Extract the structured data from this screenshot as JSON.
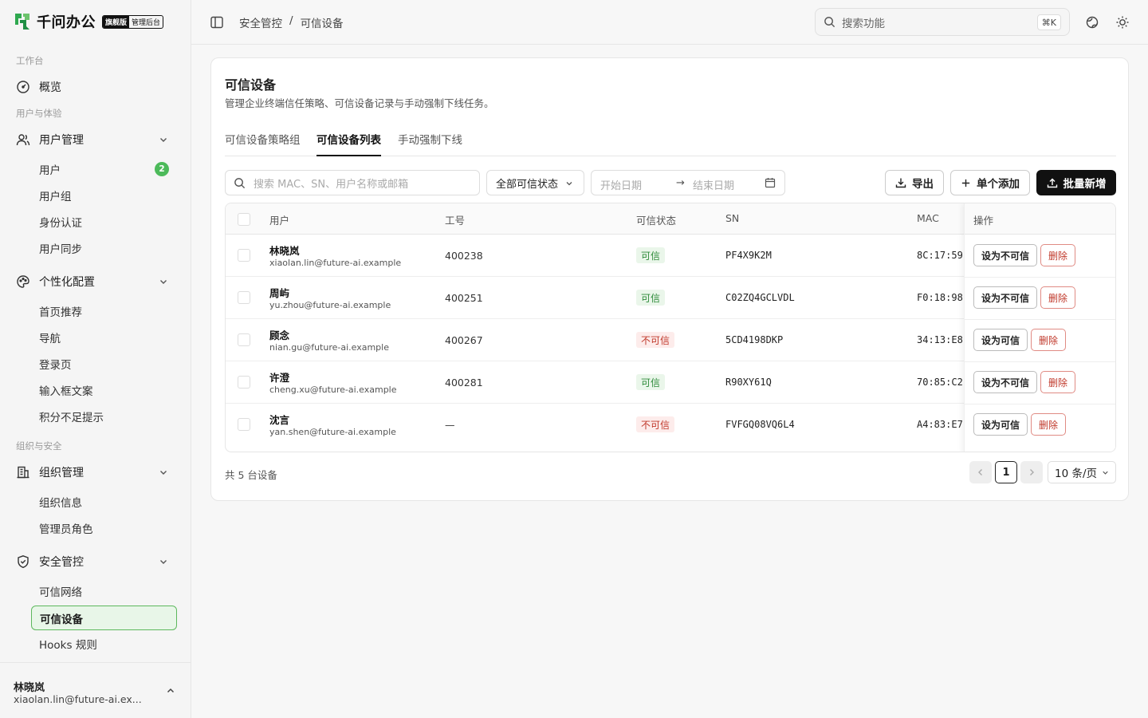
{
  "brand": {
    "name": "千问办公",
    "edition": "旗舰版",
    "console": "管理后台"
  },
  "sidebar": {
    "groups": {
      "workspace": "工作台",
      "users_exp": "用户与体验",
      "org_sec": "组织与安全"
    },
    "overview": "概览",
    "user_mgmt": {
      "label": "用户管理",
      "items": [
        {
          "label": "用户",
          "count": "2"
        },
        {
          "label": "用户组"
        },
        {
          "label": "身份认证"
        },
        {
          "label": "用户同步"
        }
      ]
    },
    "personal": {
      "label": "个性化配置",
      "items": [
        {
          "label": "首页推荐"
        },
        {
          "label": "导航"
        },
        {
          "label": "登录页"
        },
        {
          "label": "输入框文案"
        },
        {
          "label": "积分不足提示"
        }
      ]
    },
    "org_mgmt": {
      "label": "组织管理",
      "items": [
        {
          "label": "组织信息"
        },
        {
          "label": "管理员角色"
        }
      ]
    },
    "security": {
      "label": "安全管控",
      "items": [
        {
          "label": "可信网络"
        },
        {
          "label": "可信设备"
        },
        {
          "label": "Hooks 规则"
        }
      ]
    },
    "user": {
      "name": "林晓岚",
      "email": "xiaolan.lin@future-ai.ex..."
    }
  },
  "header": {
    "breadcrumb": [
      "安全管控",
      "/",
      "可信设备"
    ],
    "search_placeholder": "搜索功能",
    "shortcut": "⌘K"
  },
  "page": {
    "title": "可信设备",
    "description": "管理企业终端信任策略、可信设备记录与手动强制下线任务。",
    "tabs": [
      "可信设备策略组",
      "可信设备列表",
      "手动强制下线"
    ],
    "active_tab": 1
  },
  "toolbar": {
    "search_placeholder": "搜索 MAC、SN、用户名称或邮箱",
    "status_filter": "全部可信状态",
    "start_date": "开始日期",
    "range_arrow": "→",
    "end_date": "结束日期",
    "export": "导出",
    "add_single": "单个添加",
    "batch_add": "批量新增"
  },
  "table": {
    "columns": [
      "用户",
      "工号",
      "可信状态",
      "SN",
      "MAC",
      "操作"
    ],
    "rows": [
      {
        "name": "林晓岚",
        "email": "xiaolan.lin@future-ai.example",
        "emp_no": "400238",
        "status": "可信",
        "trusted": true,
        "sn": "PF4X9K2M",
        "mac": "8C:17:59",
        "toggle": "设为不可信",
        "delete": "删除"
      },
      {
        "name": "周屿",
        "email": "yu.zhou@future-ai.example",
        "emp_no": "400251",
        "status": "可信",
        "trusted": true,
        "sn": "C02ZQ4GCLVDL",
        "mac": "F0:18:98",
        "toggle": "设为不可信",
        "delete": "删除"
      },
      {
        "name": "顾念",
        "email": "nian.gu@future-ai.example",
        "emp_no": "400267",
        "status": "不可信",
        "trusted": false,
        "sn": "5CD4198DKP",
        "mac": "34:13:E8",
        "toggle": "设为可信",
        "delete": "删除"
      },
      {
        "name": "许澄",
        "email": "cheng.xu@future-ai.example",
        "emp_no": "400281",
        "status": "可信",
        "trusted": true,
        "sn": "R90XY61Q",
        "mac": "70:85:C2",
        "toggle": "设为不可信",
        "delete": "删除"
      },
      {
        "name": "沈言",
        "email": "yan.shen@future-ai.example",
        "emp_no": "—",
        "status": "不可信",
        "trusted": false,
        "sn": "FVFGQ08VQ6L4",
        "mac": "A4:83:E7",
        "toggle": "设为可信",
        "delete": "删除"
      }
    ]
  },
  "footer": {
    "total": "共 5 台设备",
    "prev": "<",
    "page": "1",
    "next": ">",
    "page_size": "10 条/页"
  },
  "colors": {
    "accent_green": "#4cba5a",
    "trusted": "#2e8b3a",
    "untrusted": "#c0392b",
    "primary_dark": "#111111"
  }
}
